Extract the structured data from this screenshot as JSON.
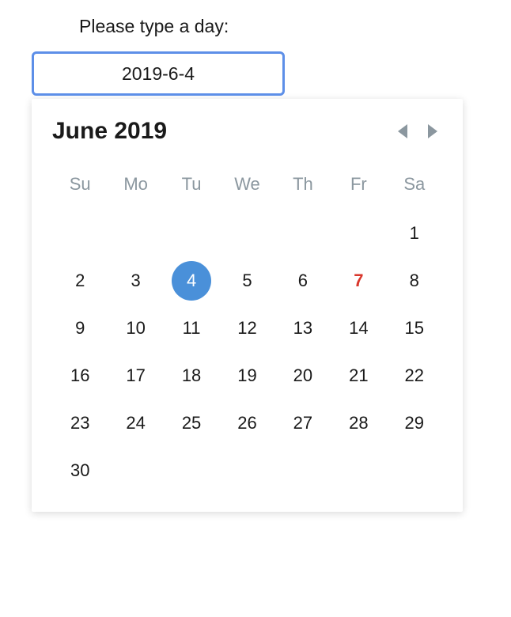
{
  "label": "Please type a day:",
  "input": {
    "value": "2019-6-4"
  },
  "calendar": {
    "title": "June 2019",
    "weekdays": [
      "Su",
      "Mo",
      "Tu",
      "We",
      "Th",
      "Fr",
      "Sa"
    ],
    "leadingEmpty": 6,
    "days": [
      1,
      2,
      3,
      4,
      5,
      6,
      7,
      8,
      9,
      10,
      11,
      12,
      13,
      14,
      15,
      16,
      17,
      18,
      19,
      20,
      21,
      22,
      23,
      24,
      25,
      26,
      27,
      28,
      29,
      30
    ],
    "selected": 4,
    "today": 7
  }
}
